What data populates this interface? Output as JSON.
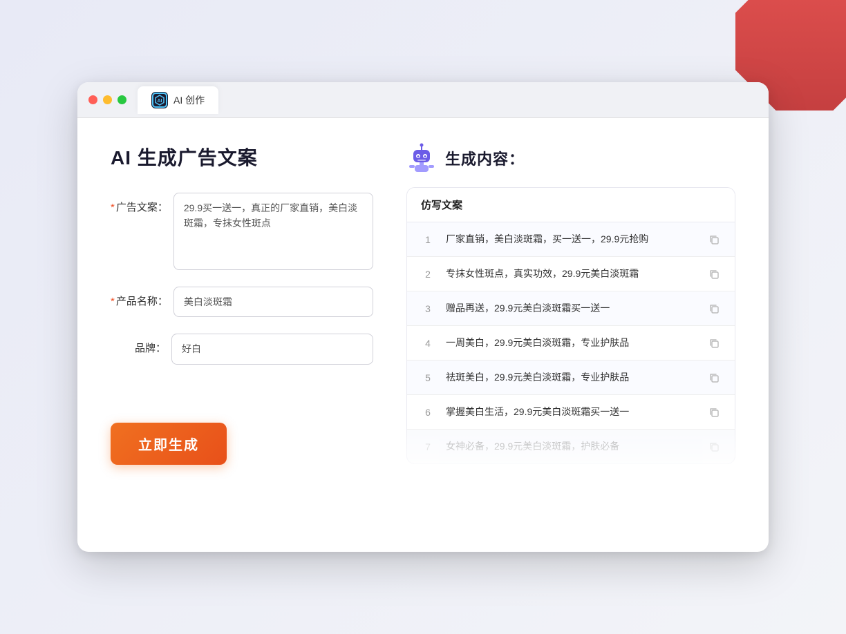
{
  "colors": {
    "accent_orange": "#f07020",
    "accent_purple": "#7c6ef0",
    "required_red": "#f04e23",
    "text_dark": "#1a1a2e",
    "text_muted": "#999"
  },
  "browser": {
    "tab_label": "AI 创作",
    "traffic_lights": [
      "red",
      "yellow",
      "green"
    ]
  },
  "page": {
    "title": "AI 生成广告文案",
    "result_section_title": "生成内容："
  },
  "form": {
    "ad_copy_label": "广告文案：",
    "ad_copy_required": "*",
    "ad_copy_value": "29.9买一送一，真正的厂家直销，美白淡斑霜，专抹女性斑点",
    "product_name_label": "产品名称：",
    "product_name_required": "*",
    "product_name_value": "美白淡斑霜",
    "brand_label": "品牌：",
    "brand_value": "好白",
    "generate_button_label": "立即生成"
  },
  "results": {
    "column_header": "仿写文案",
    "items": [
      {
        "num": "1",
        "text": "厂家直销，美白淡斑霜，买一送一，29.9元抢购",
        "faded": false
      },
      {
        "num": "2",
        "text": "专抹女性斑点，真实功效，29.9元美白淡斑霜",
        "faded": false
      },
      {
        "num": "3",
        "text": "赠品再送，29.9元美白淡斑霜买一送一",
        "faded": false
      },
      {
        "num": "4",
        "text": "一周美白，29.9元美白淡斑霜，专业护肤品",
        "faded": false
      },
      {
        "num": "5",
        "text": "祛斑美白，29.9元美白淡斑霜，专业护肤品",
        "faded": false
      },
      {
        "num": "6",
        "text": "掌握美白生活，29.9元美白淡斑霜买一送一",
        "faded": false
      },
      {
        "num": "7",
        "text": "女神必备，29.9元美白淡斑霜，护肤必备",
        "faded": true
      }
    ]
  }
}
